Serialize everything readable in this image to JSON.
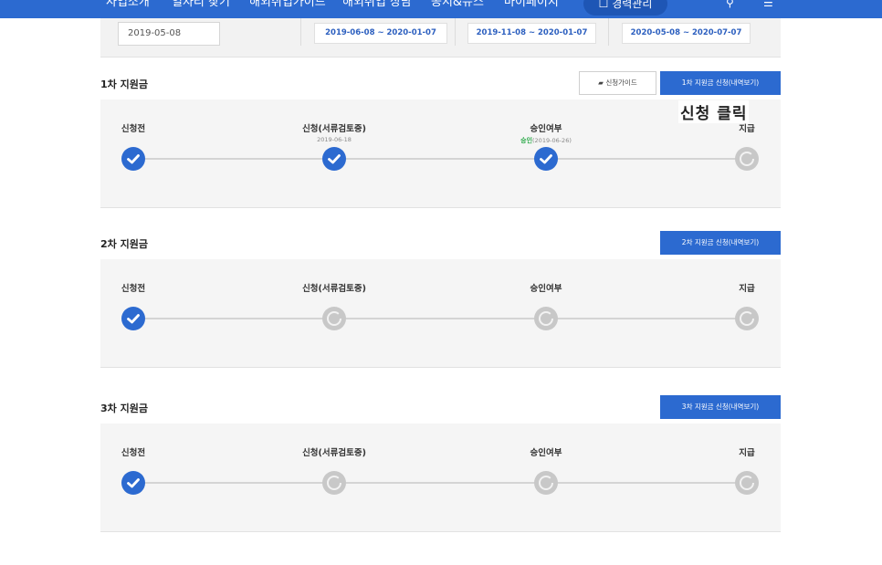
{
  "nav": {
    "items": [
      "사업소개",
      "일자리 찾기",
      "해외취업가이드",
      "해외취업 상담",
      "공지&뉴스",
      "마이페이지"
    ],
    "career_button": "경력관리"
  },
  "summary": {
    "date_value": "2019-05-08",
    "periods": [
      "2019-06-08 ~ 2020-01-07",
      "2019-11-08 ~ 2020-01-07",
      "2020-05-08 ~ 2020-07-07"
    ]
  },
  "steps": [
    "신청전",
    "신청(서류검토중)",
    "승인여부",
    "지급"
  ],
  "rounds": [
    {
      "title": "1차 지원금",
      "guide_button": "신청가이드",
      "apply_button": "1차 지원금 신청(내역보기)",
      "apply_date": "2019-06-18",
      "approval_status": "승인",
      "approval_date": "(2019-06-26)",
      "status": [
        "done",
        "done",
        "done",
        "todo"
      ]
    },
    {
      "title": "2차 지원금",
      "apply_button": "2차 지원금 신청(내역보기)",
      "status": [
        "done",
        "todo",
        "todo",
        "todo"
      ]
    },
    {
      "title": "3차 지원금",
      "apply_button": "3차 지원금 신청(내역보기)",
      "status": [
        "done",
        "todo",
        "todo",
        "todo"
      ]
    }
  ],
  "annotation": "신청 클릭",
  "colors": {
    "primary": "#2c6ad0",
    "approved": "#2eaa4b",
    "pending": "#c8c8c8"
  }
}
